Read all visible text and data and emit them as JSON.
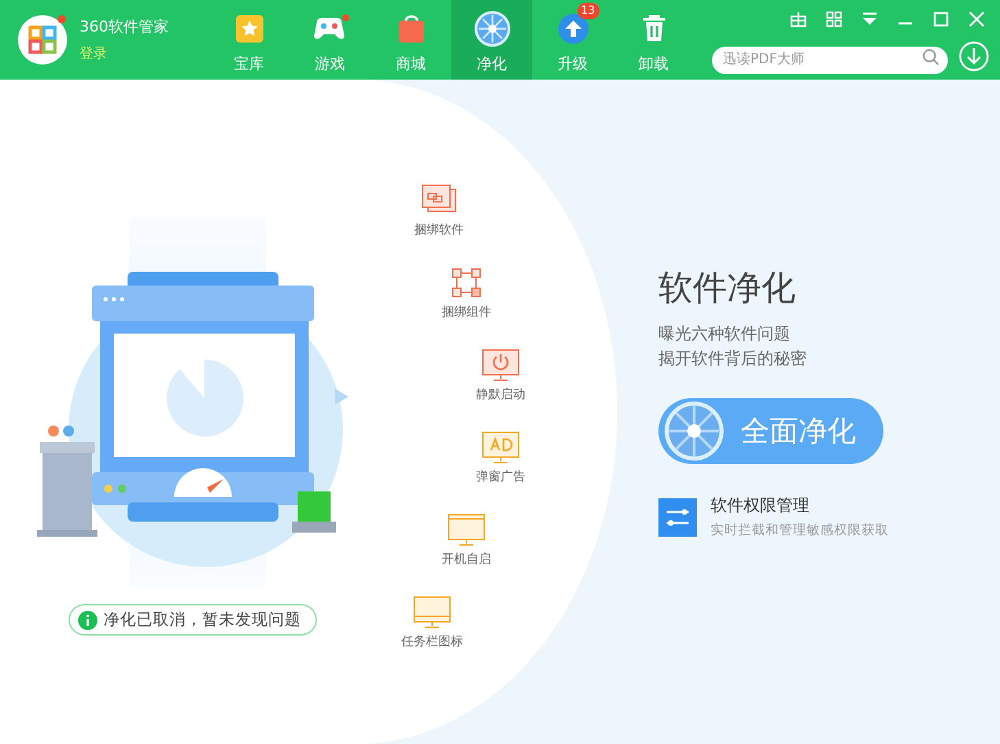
{
  "app": {
    "title": "360软件管家",
    "login": "登录"
  },
  "tabs": [
    {
      "label": "宝库",
      "selected": false
    },
    {
      "label": "游戏",
      "selected": false
    },
    {
      "label": "商城",
      "selected": false
    },
    {
      "label": "净化",
      "selected": true
    },
    {
      "label": "升级",
      "selected": false,
      "badge": "13"
    },
    {
      "label": "卸载",
      "selected": false
    }
  ],
  "search": {
    "placeholder": "迅读PDF大师"
  },
  "features": [
    {
      "label": "捆绑软件"
    },
    {
      "label": "捆绑组件"
    },
    {
      "label": "静默启动"
    },
    {
      "label": "弹窗广告"
    },
    {
      "label": "开机自启"
    },
    {
      "label": "任务栏图标"
    }
  ],
  "status": "净化已取消，暂未发现问题",
  "panel": {
    "title": "软件净化",
    "lines": [
      "曝光六种软件问题",
      "揭开软件背后的秘密"
    ],
    "button": "全面净化",
    "permission": {
      "title": "软件权限管理",
      "subtitle": "实时拦截和管理敏感权限获取"
    }
  }
}
